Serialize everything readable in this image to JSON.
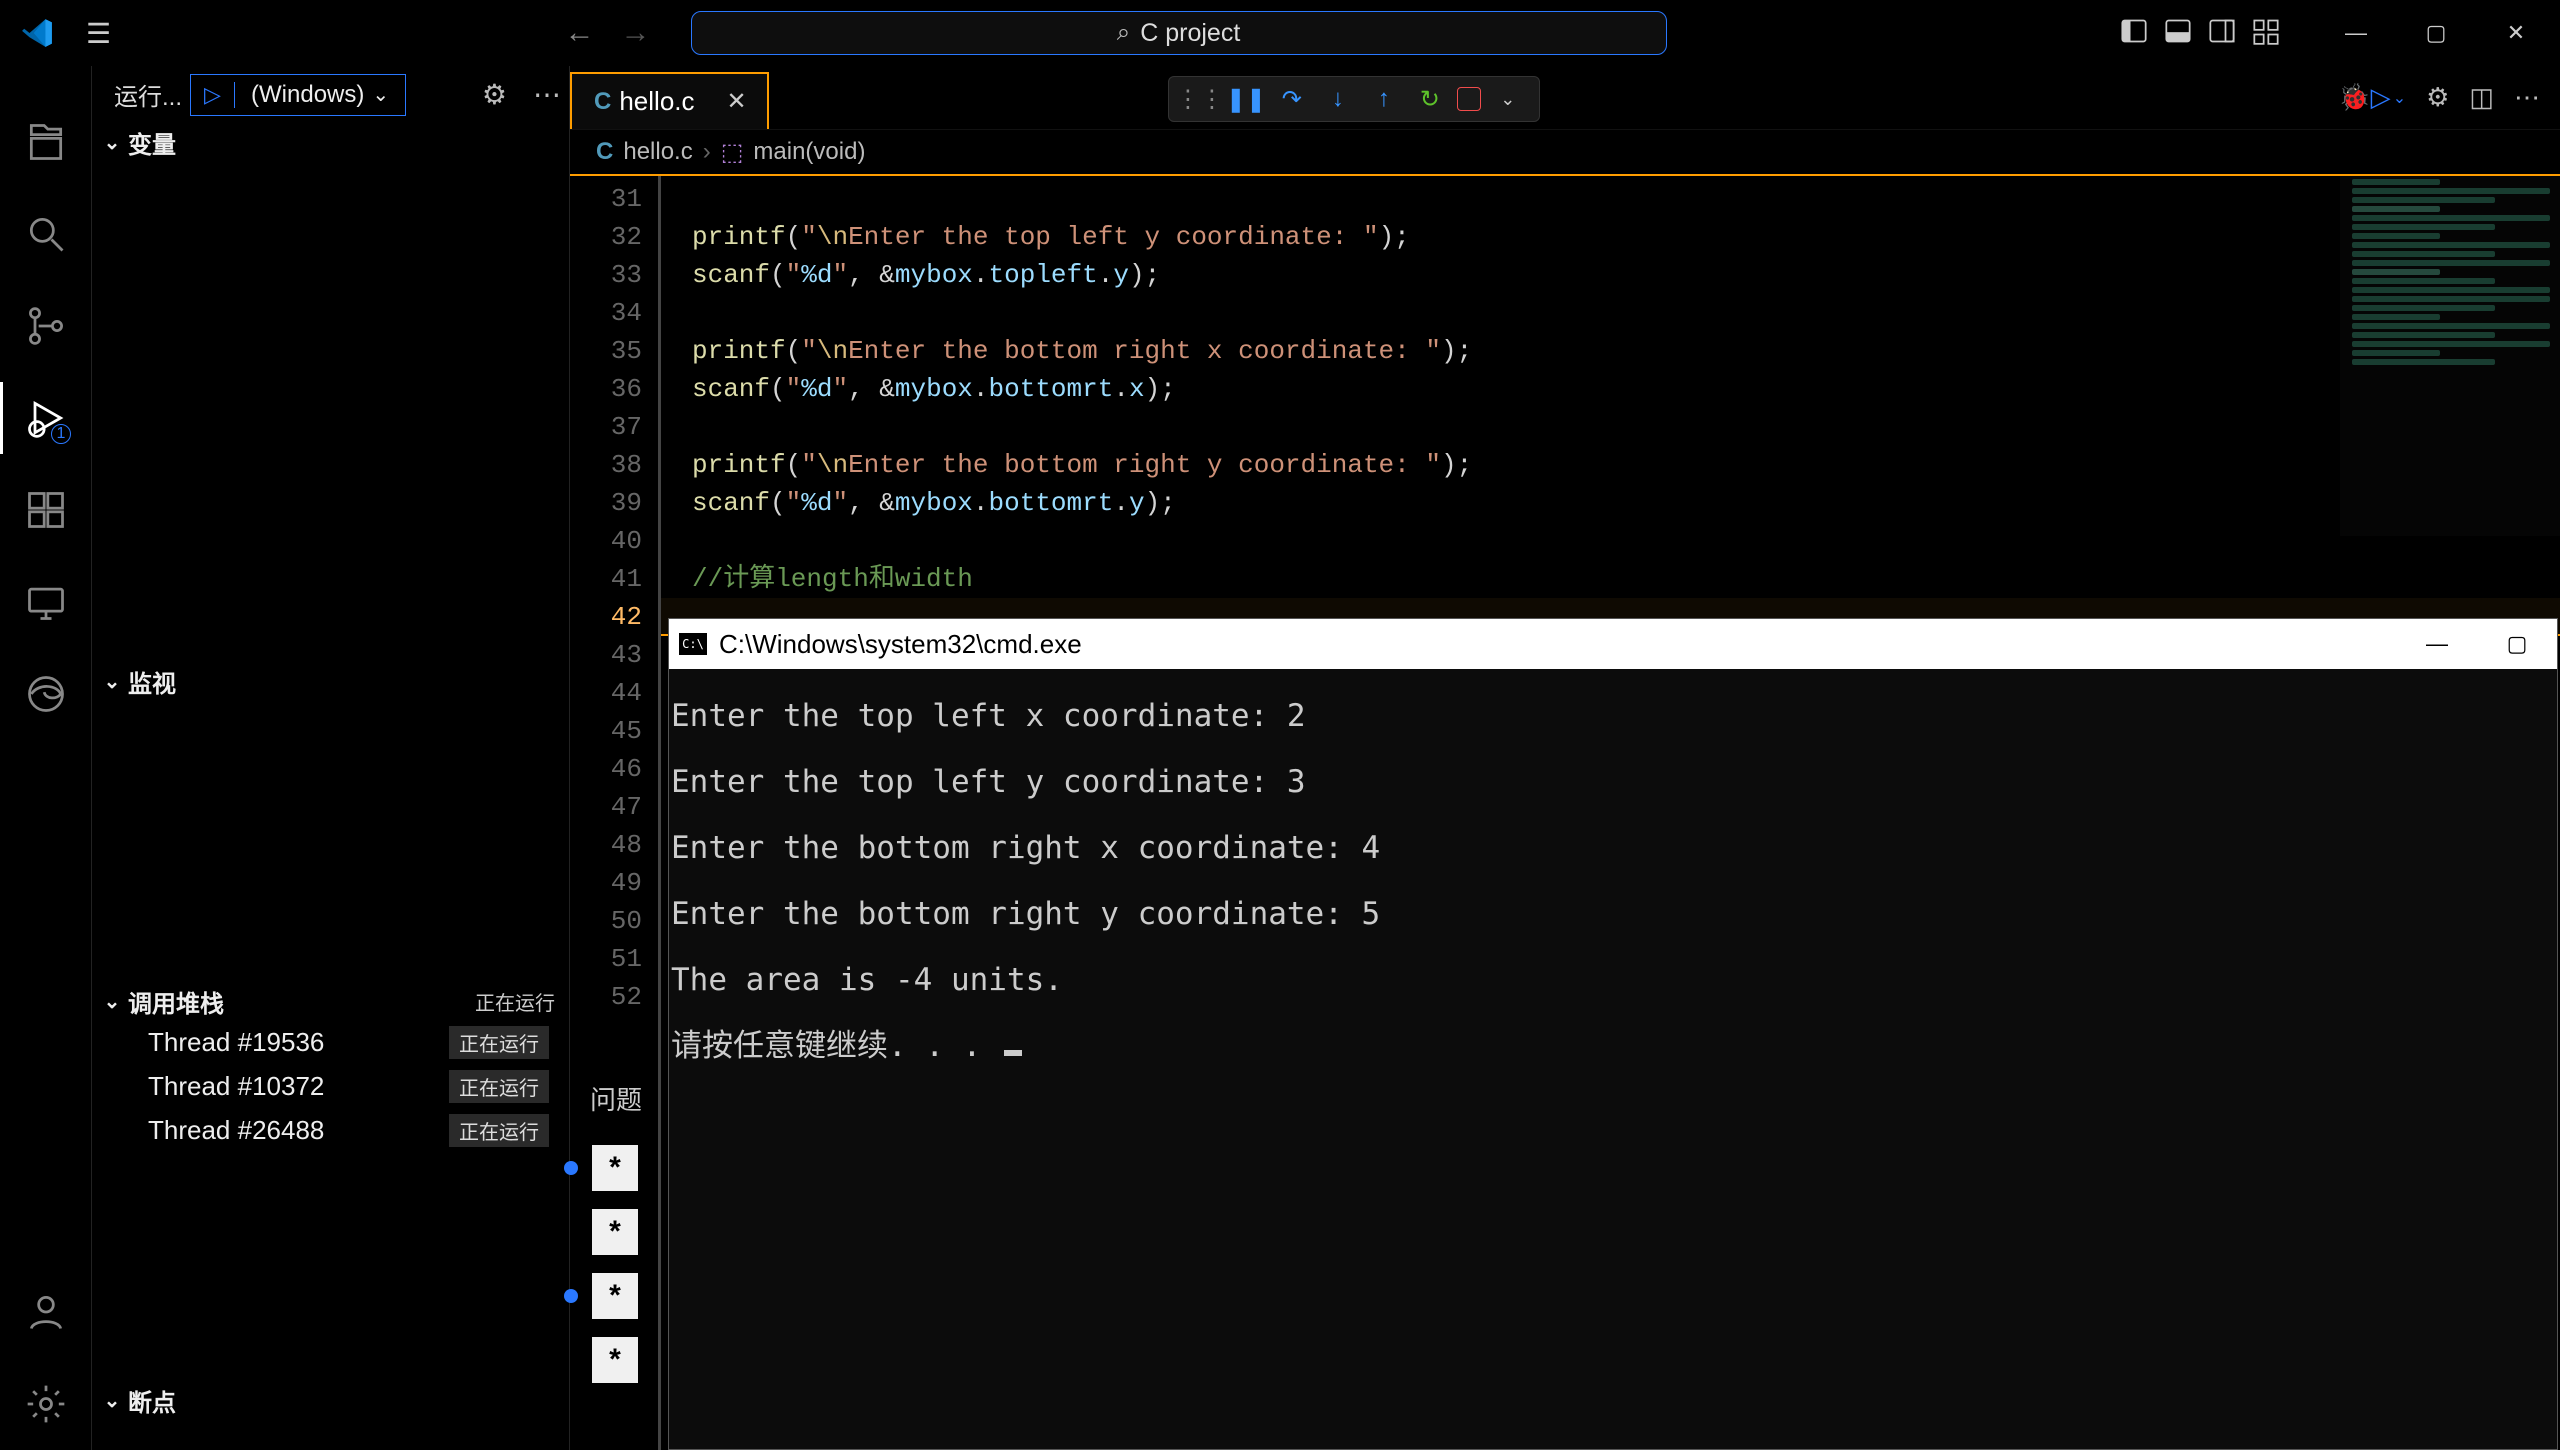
{
  "titlebar": {
    "search_placeholder": "C project"
  },
  "sidepanel": {
    "title": "运行...",
    "config_name": "(Windows)",
    "sections": {
      "variables": "变量",
      "watch": "监视",
      "callstack": "调用堆栈",
      "callstack_status": "正在运行",
      "breakpoints": "断点"
    },
    "threads": [
      {
        "name": "Thread #19536",
        "state": "正在运行"
      },
      {
        "name": "Thread #10372",
        "state": "正在运行"
      },
      {
        "name": "Thread #26488",
        "state": "正在运行"
      }
    ]
  },
  "tabs": {
    "file_name": "hello.c",
    "file_icon_letter": "C"
  },
  "breadcrumb": {
    "file_icon_letter": "C",
    "file": "hello.c",
    "symbol": "main(void)"
  },
  "editor": {
    "lines": [
      {
        "n": 31,
        "seg": []
      },
      {
        "n": 32,
        "seg": [
          [
            "fn",
            "printf"
          ],
          [
            "punc",
            "("
          ],
          [
            "str",
            "\""
          ],
          [
            "esc",
            "\\n"
          ],
          [
            "str",
            "Enter the top left y coordinate: "
          ],
          [
            "str",
            "\""
          ],
          [
            "punc",
            ")"
          ],
          [
            "punc",
            ";"
          ]
        ]
      },
      {
        "n": 33,
        "seg": [
          [
            "fn",
            "scanf"
          ],
          [
            "punc",
            "("
          ],
          [
            "str",
            "\""
          ],
          [
            "fmt",
            "%d"
          ],
          [
            "str",
            "\""
          ],
          [
            "punc",
            ", "
          ],
          [
            "op",
            "&"
          ],
          [
            "var",
            "mybox"
          ],
          [
            "punc",
            "."
          ],
          [
            "var",
            "topleft"
          ],
          [
            "punc",
            "."
          ],
          [
            "var",
            "y"
          ],
          [
            "punc",
            ")"
          ],
          [
            "punc",
            ";"
          ]
        ]
      },
      {
        "n": 34,
        "seg": []
      },
      {
        "n": 35,
        "seg": [
          [
            "fn",
            "printf"
          ],
          [
            "punc",
            "("
          ],
          [
            "str",
            "\""
          ],
          [
            "esc",
            "\\n"
          ],
          [
            "str",
            "Enter the bottom right x coordinate: "
          ],
          [
            "str",
            "\""
          ],
          [
            "punc",
            ")"
          ],
          [
            "punc",
            ";"
          ]
        ]
      },
      {
        "n": 36,
        "seg": [
          [
            "fn",
            "scanf"
          ],
          [
            "punc",
            "("
          ],
          [
            "str",
            "\""
          ],
          [
            "fmt",
            "%d"
          ],
          [
            "str",
            "\""
          ],
          [
            "punc",
            ", "
          ],
          [
            "op",
            "&"
          ],
          [
            "var",
            "mybox"
          ],
          [
            "punc",
            "."
          ],
          [
            "var",
            "bottomrt"
          ],
          [
            "punc",
            "."
          ],
          [
            "var",
            "x"
          ],
          [
            "punc",
            ")"
          ],
          [
            "punc",
            ";"
          ]
        ]
      },
      {
        "n": 37,
        "seg": []
      },
      {
        "n": 38,
        "seg": [
          [
            "fn",
            "printf"
          ],
          [
            "punc",
            "("
          ],
          [
            "str",
            "\""
          ],
          [
            "esc",
            "\\n"
          ],
          [
            "str",
            "Enter the bottom right y coordinate: "
          ],
          [
            "str",
            "\""
          ],
          [
            "punc",
            ")"
          ],
          [
            "punc",
            ";"
          ]
        ]
      },
      {
        "n": 39,
        "seg": [
          [
            "fn",
            "scanf"
          ],
          [
            "punc",
            "("
          ],
          [
            "str",
            "\""
          ],
          [
            "fmt",
            "%d"
          ],
          [
            "str",
            "\""
          ],
          [
            "punc",
            ", "
          ],
          [
            "op",
            "&"
          ],
          [
            "var",
            "mybox"
          ],
          [
            "punc",
            "."
          ],
          [
            "var",
            "bottomrt"
          ],
          [
            "punc",
            "."
          ],
          [
            "var",
            "y"
          ],
          [
            "punc",
            ")"
          ],
          [
            "punc",
            ";"
          ]
        ]
      },
      {
        "n": 40,
        "seg": []
      },
      {
        "n": 41,
        "seg": [
          [
            "cmt",
            "//计算length和width"
          ]
        ]
      },
      {
        "n": 42,
        "seg": [],
        "active": true
      },
      {
        "n": 43,
        "seg": []
      },
      {
        "n": 44,
        "seg": []
      },
      {
        "n": 45,
        "seg": []
      },
      {
        "n": 46,
        "seg": []
      },
      {
        "n": 47,
        "seg": []
      },
      {
        "n": 48,
        "seg": []
      },
      {
        "n": 49,
        "seg": []
      },
      {
        "n": 50,
        "seg": []
      },
      {
        "n": 51,
        "seg": []
      },
      {
        "n": 52,
        "seg": []
      }
    ]
  },
  "problems": {
    "label": "问题",
    "markers": [
      {
        "glyph": "*",
        "dot": true
      },
      {
        "glyph": "*",
        "dot": false
      },
      {
        "glyph": "*",
        "dot": true
      },
      {
        "glyph": "*",
        "dot": false
      }
    ]
  },
  "cmd": {
    "title": "C:\\Windows\\system32\\cmd.exe",
    "lines": [
      "Enter the top left x coordinate: 2",
      "",
      "Enter the top left y coordinate: 3",
      "",
      "Enter the bottom right x coordinate: 4",
      "",
      "Enter the bottom right y coordinate: 5",
      "",
      "The area is -4 units.",
      "",
      "请按任意键继续. . . "
    ]
  }
}
